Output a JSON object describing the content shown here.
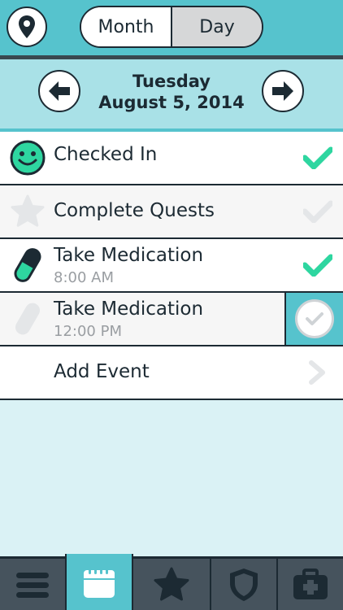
{
  "header": {
    "segments": {
      "month": "Month",
      "day": "Day",
      "selected": "day"
    },
    "location_icon": "map-pin-icon"
  },
  "date_nav": {
    "day_name": "Tuesday",
    "date": "August 5, 2014",
    "prev_icon": "arrow-left-icon",
    "next_icon": "arrow-right-icon"
  },
  "events": [
    {
      "title": "Checked In",
      "subtitle": "",
      "icon": "smiley-icon",
      "status": "done"
    },
    {
      "title": "Complete Quests",
      "subtitle": "",
      "icon": "star-icon",
      "status": "pending"
    },
    {
      "title": "Take Medication",
      "subtitle": "8:00 AM",
      "icon": "pill-icon",
      "status": "done"
    },
    {
      "title": "Take Medication",
      "subtitle": "12:00 PM",
      "icon": "pill-icon",
      "status": "to-check"
    },
    {
      "title": "Add Event",
      "subtitle": "",
      "icon": "chevron-right-icon",
      "status": "action"
    }
  ],
  "tabs": [
    {
      "name": "menu-icon",
      "active": false
    },
    {
      "name": "calendar-icon",
      "active": true
    },
    {
      "name": "star-icon",
      "active": false
    },
    {
      "name": "shield-icon",
      "active": false
    },
    {
      "name": "medical-kit-icon",
      "active": false
    }
  ],
  "colors": {
    "teal": "#56c3cd",
    "light_teal": "#a9e1e7",
    "green_check": "#2ed6a0",
    "dark": "#1c2a33",
    "gray_check": "#e4e6e8"
  }
}
